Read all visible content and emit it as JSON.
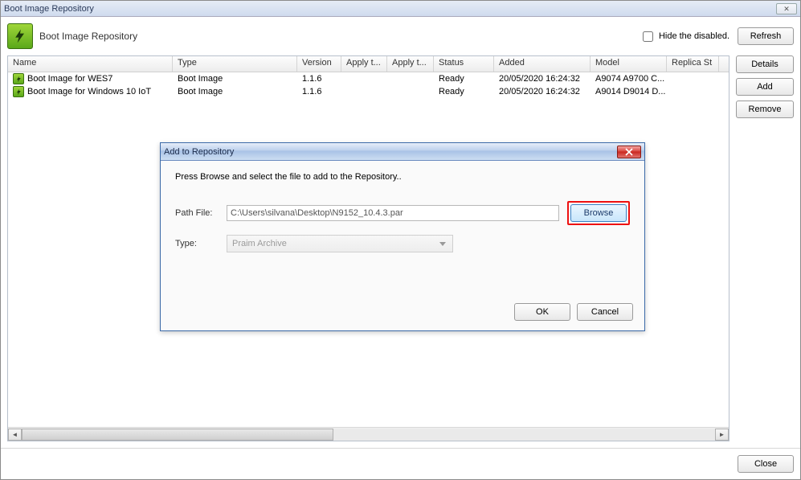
{
  "window": {
    "title": "Boot Image Repository"
  },
  "header": {
    "title": "Boot Image Repository"
  },
  "toolbar": {
    "hide_disabled_label": "Hide the disabled.",
    "hide_disabled_checked": false,
    "refresh_label": "Refresh"
  },
  "side": {
    "details_label": "Details",
    "add_label": "Add",
    "remove_label": "Remove"
  },
  "grid": {
    "columns": {
      "name": "Name",
      "type": "Type",
      "version": "Version",
      "apply_t1": "Apply t...",
      "apply_t2": "Apply t...",
      "status": "Status",
      "added": "Added",
      "model": "Model",
      "replica": "Replica St"
    },
    "rows": [
      {
        "name": "Boot Image for WES7",
        "type": "Boot Image",
        "version": "1.1.6",
        "apply_t1": "",
        "apply_t2": "",
        "status": "Ready",
        "added": "20/05/2020 16:24:32",
        "model": "A9074 A9700 C...",
        "replica": ""
      },
      {
        "name": "Boot Image for Windows 10 IoT",
        "type": "Boot Image",
        "version": "1.1.6",
        "apply_t1": "",
        "apply_t2": "",
        "status": "Ready",
        "added": "20/05/2020 16:24:32",
        "model": "A9014 D9014 D...",
        "replica": ""
      }
    ]
  },
  "footer": {
    "close_label": "Close"
  },
  "modal": {
    "title": "Add to Repository",
    "instruction": "Press Browse and select the file to add to the Repository..",
    "path_label": "Path File:",
    "path_value": "C:\\Users\\silvana\\Desktop\\N9152_10.4.3.par",
    "type_label": "Type:",
    "type_value": "Praim Archive",
    "browse_label": "Browse",
    "ok_label": "OK",
    "cancel_label": "Cancel"
  }
}
